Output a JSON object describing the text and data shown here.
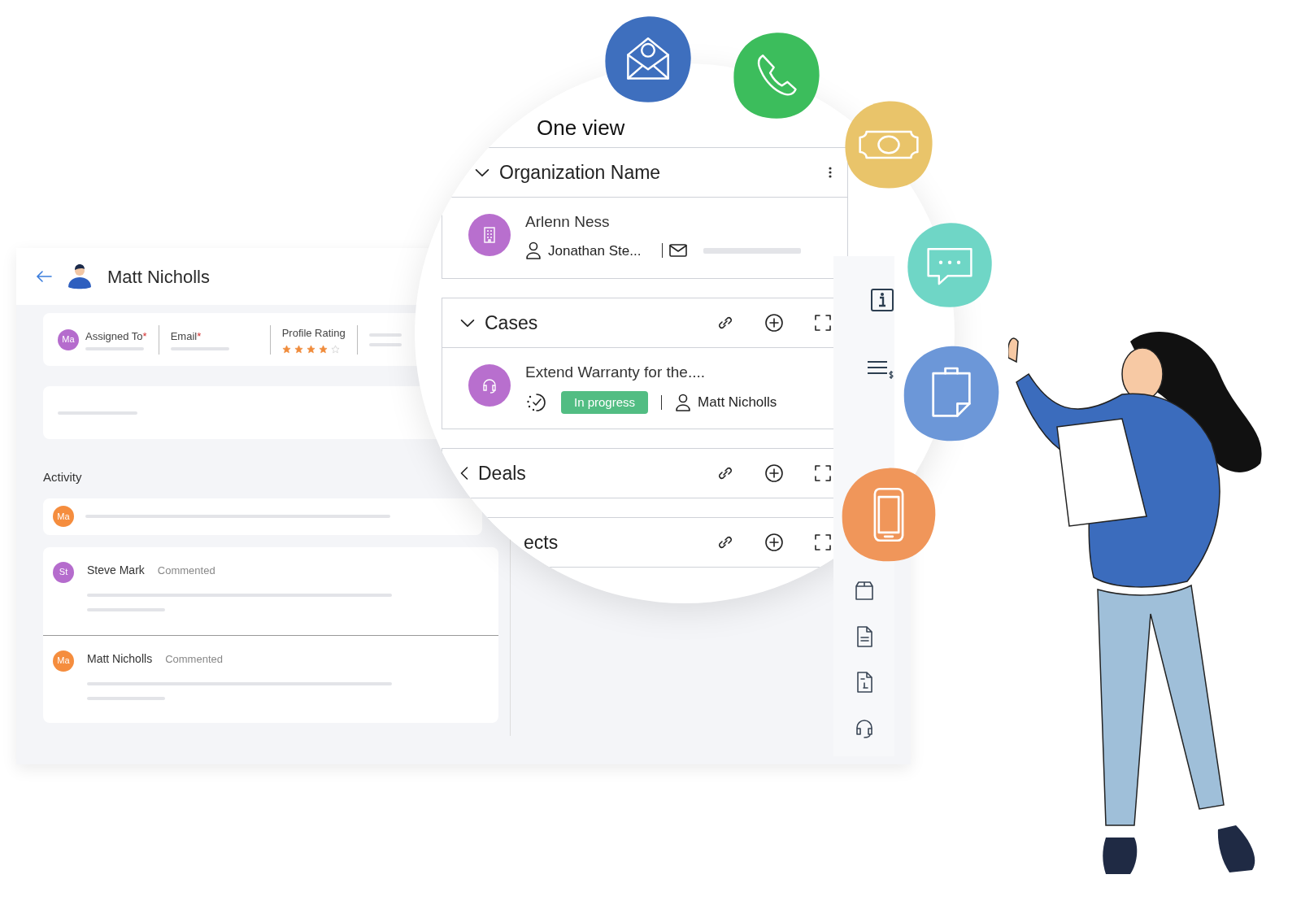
{
  "record": {
    "title": "Matt Nicholls"
  },
  "fields": [
    {
      "avatar": "Ma",
      "label": "Assigned To",
      "mark": "*"
    },
    {
      "label": "Email",
      "mark": "*"
    },
    {
      "label": "Profile Rating",
      "stars": 4
    }
  ],
  "activity": {
    "heading": "Activity",
    "composer_avatar": "Ma",
    "entries": [
      {
        "avatar": "St",
        "name": "Steve Mark",
        "action": "Commented",
        "color": "#b56ccd"
      },
      {
        "avatar": "Ma",
        "name": "Matt Nicholls",
        "action": "Commented",
        "color": "#f58d3e"
      }
    ]
  },
  "one_view": {
    "title": "One view",
    "sections": [
      {
        "kind": "org",
        "title": "Organization Name",
        "expanded": true,
        "record": {
          "name": "Arlenn Ness",
          "contact": "Jonathan Ste..."
        }
      },
      {
        "kind": "cases",
        "title": "Cases",
        "expanded": true,
        "record": {
          "title": "Extend Warranty for the....",
          "status": "In progress",
          "owner": "Matt Nicholls"
        }
      },
      {
        "kind": "related",
        "title": "Deals",
        "expanded": false
      },
      {
        "kind": "clipped",
        "title": "ects"
      }
    ]
  }
}
